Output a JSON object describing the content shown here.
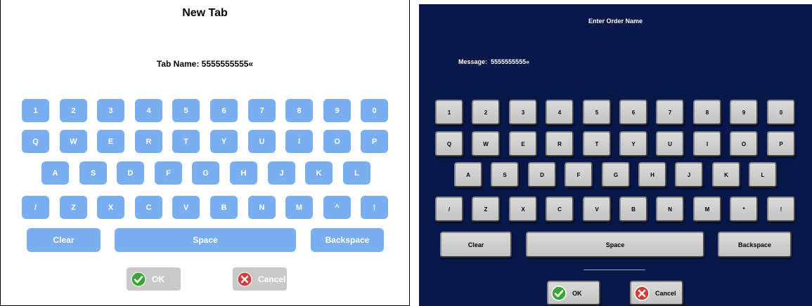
{
  "left": {
    "title": "New Tab",
    "message": "Tab Name: 5555555555«",
    "keys": {
      "row1": [
        "1",
        "2",
        "3",
        "4",
        "5",
        "6",
        "7",
        "8",
        "9",
        "0"
      ],
      "row2": [
        "Q",
        "W",
        "E",
        "R",
        "T",
        "Y",
        "U",
        "I",
        "O",
        "P"
      ],
      "row3": [
        "A",
        "S",
        "D",
        "F",
        "G",
        "H",
        "J",
        "K",
        "L"
      ],
      "row4": [
        "/",
        "Z",
        "X",
        "C",
        "V",
        "B",
        "N",
        "M",
        "^",
        "!"
      ]
    },
    "clear_label": "Clear",
    "space_label": "Space",
    "backspace_label": "Backspace",
    "ok_label": "OK",
    "cancel_label": "Cancel"
  },
  "right": {
    "title": "Enter Order Name",
    "message": "Message:  5555555555«",
    "keys": {
      "row1": [
        "1",
        "2",
        "3",
        "4",
        "5",
        "6",
        "7",
        "8",
        "9",
        "0"
      ],
      "row2": [
        "Q",
        "W",
        "E",
        "R",
        "T",
        "Y",
        "U",
        "I",
        "O",
        "P"
      ],
      "row3": [
        "A",
        "S",
        "D",
        "F",
        "G",
        "H",
        "J",
        "K",
        "L"
      ],
      "row4": [
        "/",
        "Z",
        "X",
        "C",
        "V",
        "B",
        "N",
        "M",
        "*",
        "!"
      ]
    },
    "clear_label": "Clear",
    "space_label": "Space",
    "backspace_label": "Backspace",
    "ok_label": "OK",
    "cancel_label": "Cancel"
  },
  "colors": {
    "left_key": "#79aef0",
    "right_background": "#08174a",
    "ok_icon": "#3aa53a",
    "cancel_icon": "#d43a3a"
  },
  "icons": {
    "ok": "checkmark-icon",
    "cancel": "x-circle-icon"
  }
}
